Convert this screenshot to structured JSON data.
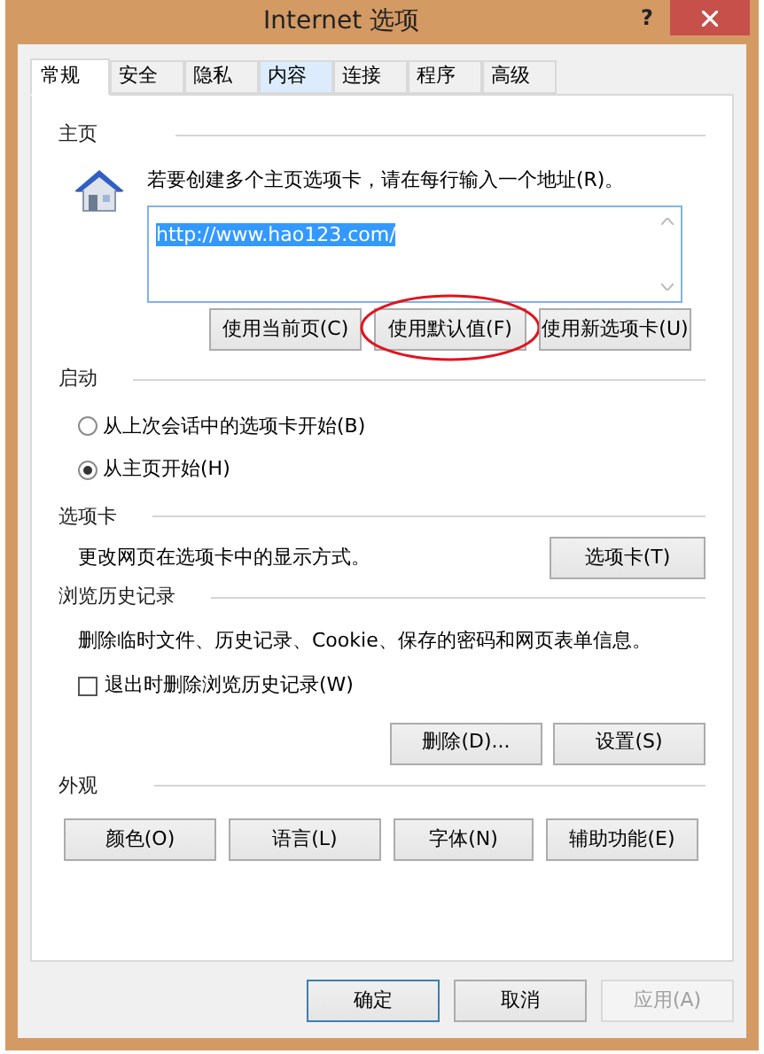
{
  "window": {
    "title": "Internet 选项",
    "help": "?"
  },
  "tabs": [
    {
      "label": "常规",
      "selected": true,
      "hovered": false
    },
    {
      "label": "安全",
      "selected": false,
      "hovered": false
    },
    {
      "label": "隐私",
      "selected": false,
      "hovered": false
    },
    {
      "label": "内容",
      "selected": false,
      "hovered": true
    },
    {
      "label": "连接",
      "selected": false,
      "hovered": false
    },
    {
      "label": "程序",
      "selected": false,
      "hovered": false
    },
    {
      "label": "高级",
      "selected": false,
      "hovered": false
    }
  ],
  "home": {
    "heading": "主页",
    "description": "若要创建多个主页选项卡，请在每行输入一个地址(R)。",
    "addresses": "http://www.hao123.com/",
    "address_selected": true,
    "buttons": [
      {
        "label": "使用当前页(C)",
        "circled": false
      },
      {
        "label": "使用默认值(F)",
        "circled": true
      },
      {
        "label": "使用新选项卡(U)",
        "circled": false
      }
    ]
  },
  "startup": {
    "heading": "启动",
    "options": [
      {
        "label": "从上次会话中的选项卡开始(B)",
        "selected": false
      },
      {
        "label": "从主页开始(H)",
        "selected": true
      }
    ]
  },
  "tabs_section": {
    "heading": "选项卡",
    "description": "更改网页在选项卡中的显示方式。",
    "button": "选项卡(T)"
  },
  "history": {
    "heading": "浏览历史记录",
    "description": "删除临时文件、历史记录、Cookie、保存的密码和网页表单信息。",
    "checkbox": {
      "label": "退出时删除浏览历史记录(W)",
      "checked": false
    },
    "buttons": [
      "删除(D)...",
      "设置(S)"
    ]
  },
  "appearance": {
    "heading": "外观",
    "buttons": [
      "颜色(O)",
      "语言(L)",
      "字体(N)",
      "辅助功能(E)"
    ]
  },
  "footer": [
    {
      "label": "确定",
      "default": true,
      "disabled": false
    },
    {
      "label": "取消",
      "default": false,
      "disabled": false
    },
    {
      "label": "应用(A)",
      "default": false,
      "disabled": true
    }
  ]
}
